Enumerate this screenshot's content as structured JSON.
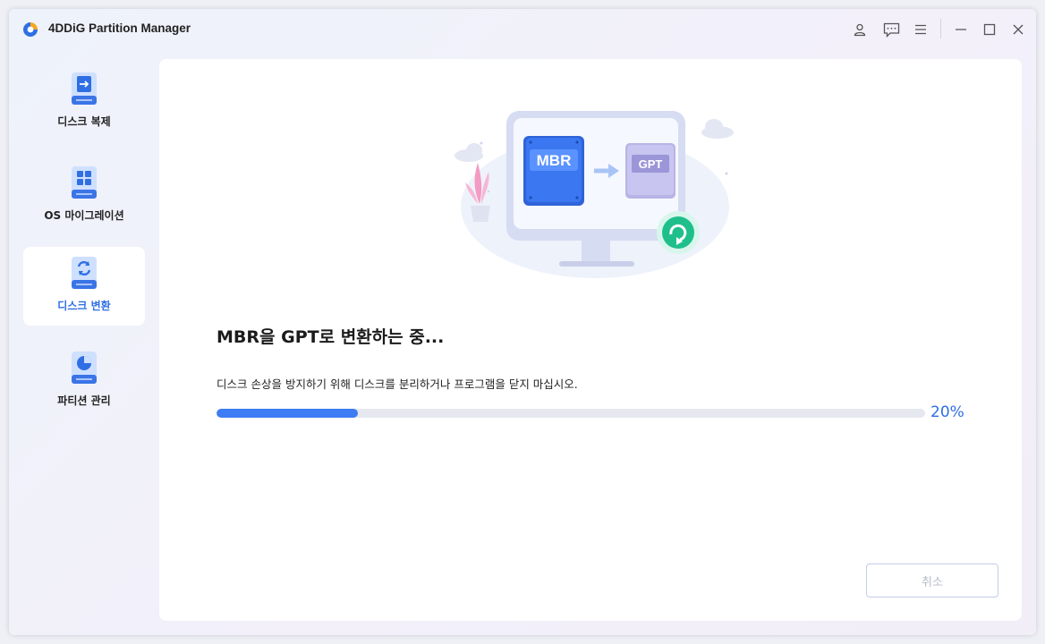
{
  "app": {
    "title": "4DDiG Partition Manager"
  },
  "titlebar": {
    "icons": [
      "account-icon",
      "feedback-icon",
      "menu-icon",
      "minimize-icon",
      "maximize-icon",
      "close-icon"
    ]
  },
  "sidebar": {
    "items": [
      {
        "label": "디스크 복제",
        "icon": "disk-clone-icon",
        "active": false
      },
      {
        "label": "OS 마이그레이션",
        "icon": "os-migration-icon",
        "active": false
      },
      {
        "label": "디스크 변환",
        "icon": "disk-convert-icon",
        "active": true
      },
      {
        "label": "파티션 관리",
        "icon": "partition-manage-icon",
        "active": false
      }
    ]
  },
  "main": {
    "illustration": {
      "from_label": "MBR",
      "to_label": "GPT"
    },
    "title": "MBR을 GPT로 변환하는 중...",
    "description": "디스크 손상을 방지하기 위해 디스크를 분리하거나 프로그램을 닫지 마십시오.",
    "progress": {
      "value": 0.2,
      "text": "20%"
    },
    "cancel_label": "취소"
  },
  "colors": {
    "accent": "#3d7cf2",
    "accent_text": "#2f6fe3",
    "active_bg": "#ffffff"
  }
}
